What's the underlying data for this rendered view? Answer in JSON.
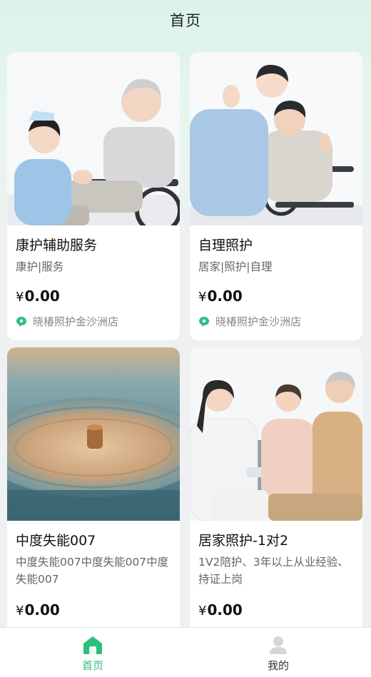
{
  "header": {
    "title": "首页"
  },
  "cards": [
    {
      "name": "康护辅助服务",
      "tags": "康护|服务",
      "currency": "¥",
      "price": "0.00",
      "store": "晓椿照护金沙洲店",
      "image": "caregiver-with-elderly-man-in-wheelchair"
    },
    {
      "name": "自理照护",
      "tags": "居家|照护|自理",
      "currency": "¥",
      "price": "0.00",
      "store": "晓椿照护金沙洲店",
      "image": "nurse-with-elderly-woman-in-wheelchair"
    },
    {
      "name": "中度失能007",
      "tags": "中度失能007中度失能007中度失能007",
      "currency": "¥",
      "price": "0.00",
      "image": "vinyl-record-closeup"
    },
    {
      "name": "居家照护-1对2",
      "tags": "1V2陪护、3年以上从业经验、持证上岗",
      "currency": "¥",
      "price": "0.00",
      "image": "doctor-with-elderly-couple"
    }
  ],
  "tabbar": {
    "home": {
      "label": "首页",
      "icon": "home-icon"
    },
    "mine": {
      "label": "我的",
      "icon": "user-icon"
    }
  },
  "colors": {
    "accent": "#2bbf7e",
    "header_bg": "#dcf3ea",
    "page_bg": "#eef0f1"
  }
}
